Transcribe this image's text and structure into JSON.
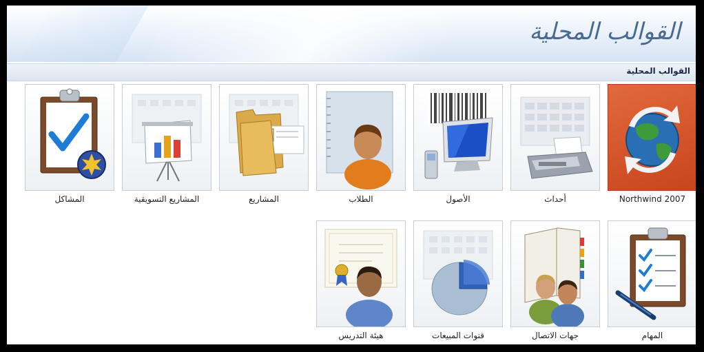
{
  "banner": {
    "title": "القوالب المحلية"
  },
  "section": {
    "label": "القوالب المحلية"
  },
  "templates": [
    {
      "label": "Northwind 2007"
    },
    {
      "label": "أحداث"
    },
    {
      "label": "الأصول"
    },
    {
      "label": "الطلاب"
    },
    {
      "label": "المشاريع"
    },
    {
      "label": "المشاريع التسويقية"
    },
    {
      "label": "المشاكل"
    },
    {
      "label": "المهام"
    },
    {
      "label": "جهات الاتصال"
    },
    {
      "label": "قنوات المبيعات"
    },
    {
      "label": "هيئة التدريس"
    }
  ],
  "icons": {
    "northwind": "globe-refresh-icon",
    "events": "fax-calendar-icon",
    "assets": "computer-barcode-icon",
    "students": "student-notebook-icon",
    "projects": "folder-icon",
    "marketing": "presentation-chart-icon",
    "issues": "clipboard-check-icon",
    "tasks": "clipboard-checklist-icon",
    "contacts": "contacts-book-icon",
    "sales": "pie-chart-icon",
    "faculty": "faculty-certificate-icon"
  },
  "colors": {
    "accent": "#4a6a93",
    "northwind_bg": "#d4582c"
  }
}
